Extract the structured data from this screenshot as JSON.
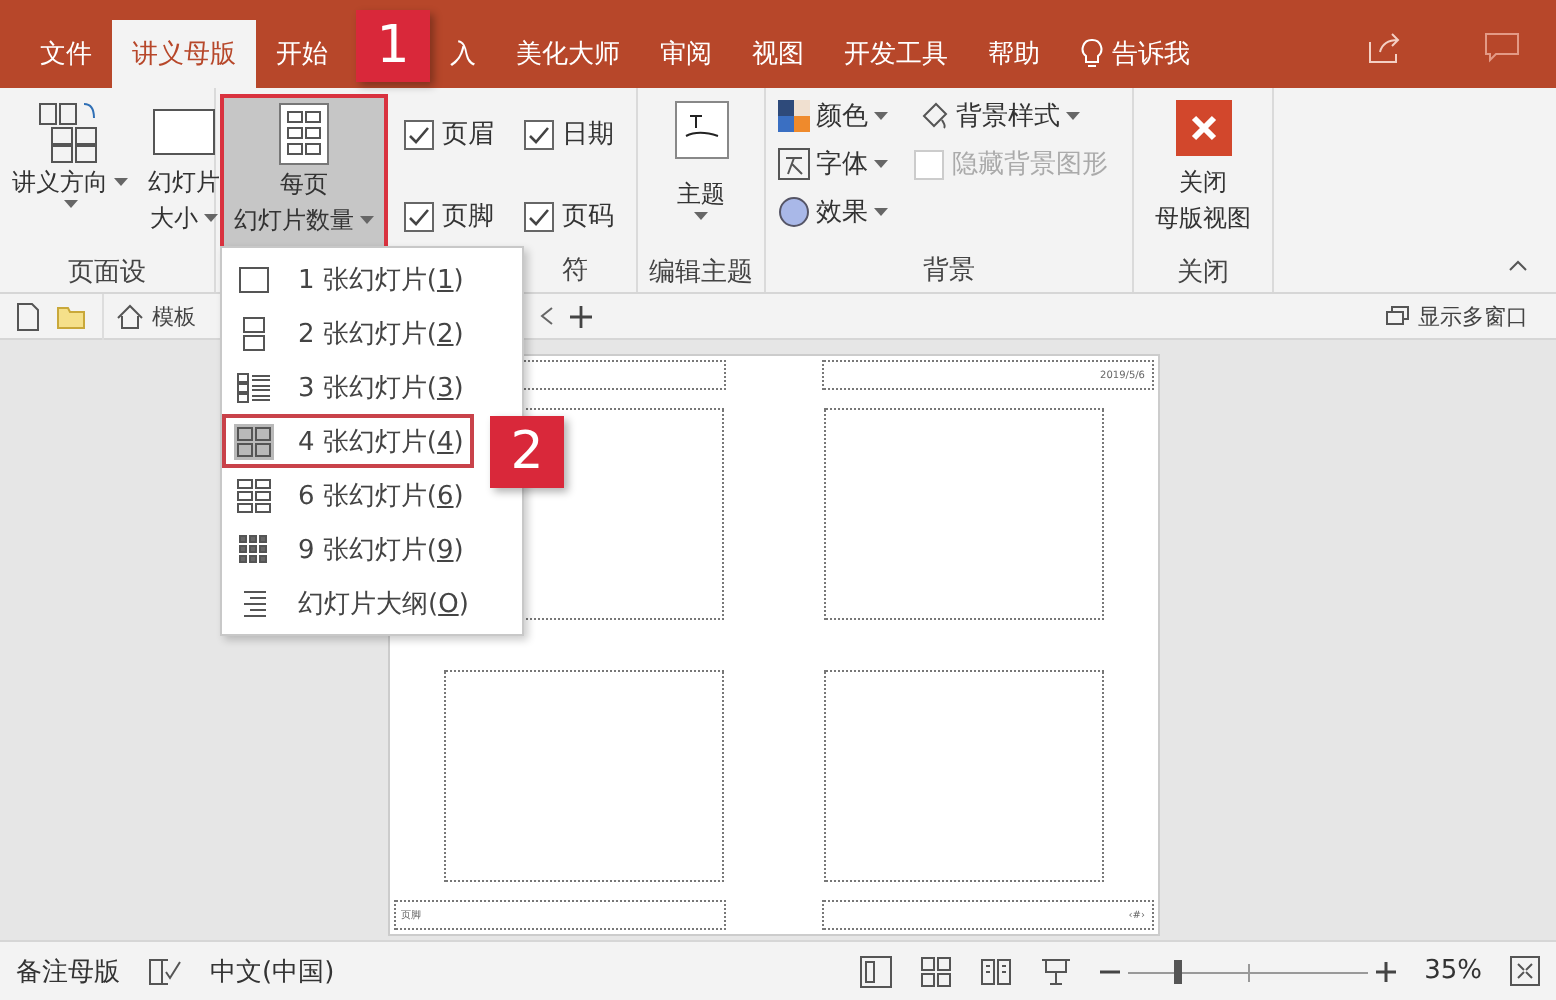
{
  "ribbon_tabs": [
    {
      "label": "文件",
      "selected": false
    },
    {
      "label": "讲义母版",
      "selected": true
    },
    {
      "label": "开始",
      "selected": false
    },
    {
      "label": "入",
      "selected": false,
      "badge": "1"
    },
    {
      "label": "美化大师",
      "selected": false
    },
    {
      "label": "审阅",
      "selected": false
    },
    {
      "label": "视图",
      "selected": false
    },
    {
      "label": "开发工具",
      "selected": false
    },
    {
      "label": "帮助",
      "selected": false
    }
  ],
  "tell_me": "告诉我",
  "ribbon": {
    "page_setup": {
      "label": "页面设",
      "buttons": [
        {
          "lines": [
            "讲义方向"
          ],
          "kind": "orientation"
        },
        {
          "lines": [
            "幻灯片",
            "大小"
          ],
          "kind": "size"
        }
      ]
    },
    "per_page": {
      "lines": [
        "每页",
        "幻灯片数量"
      ],
      "selected": true
    },
    "placeholders": {
      "label": "符",
      "checkboxes": [
        {
          "label": "页眉",
          "checked": true
        },
        {
          "label": "日期",
          "checked": true
        },
        {
          "label": "页脚",
          "checked": true
        },
        {
          "label": "页码",
          "checked": true
        }
      ]
    },
    "theme": {
      "button": "主题",
      "label": "编辑主题"
    },
    "background": {
      "label": "背景",
      "options": [
        {
          "label": "颜色",
          "kind": "colors"
        },
        {
          "label": "字体",
          "kind": "fonts"
        },
        {
          "label": "效果",
          "kind": "effects"
        }
      ],
      "style": "背景样式",
      "hide_graphics": {
        "label": "隐藏背景图形",
        "checked": false,
        "disabled": true
      }
    },
    "close": {
      "lines": [
        "关闭",
        "母版视图"
      ],
      "label": "关闭"
    }
  },
  "doc_tabs": {
    "tab": "模板",
    "multi_window": "显示多窗口"
  },
  "menu": [
    {
      "label": "1 张幻灯片(",
      "key": "1",
      "end": ")",
      "kind": "one",
      "selected": false
    },
    {
      "label": "2 张幻灯片(",
      "key": "2",
      "end": ")",
      "kind": "two",
      "selected": false
    },
    {
      "label": "3 张幻灯片(",
      "key": "3",
      "end": ")",
      "kind": "three",
      "selected": false
    },
    {
      "label": "4 张幻灯片(",
      "key": "4",
      "end": ")",
      "kind": "four",
      "selected": true,
      "badge": "2"
    },
    {
      "label": "6 张幻灯片(",
      "key": "6",
      "end": ")",
      "kind": "six",
      "selected": false
    },
    {
      "label": "9 张幻灯片(",
      "key": "9",
      "end": ")",
      "kind": "nine",
      "selected": false
    },
    {
      "label": "幻灯片大纲(",
      "key": "O",
      "end": ")",
      "kind": "outline",
      "selected": false
    }
  ],
  "handout": {
    "date": "2019/5/6",
    "footer": "页脚",
    "page_number": "‹#›"
  },
  "status_bar": {
    "view": "备注母版",
    "language": "中文(中国)",
    "zoom": {
      "level": 0.21,
      "reading": "35%"
    }
  }
}
